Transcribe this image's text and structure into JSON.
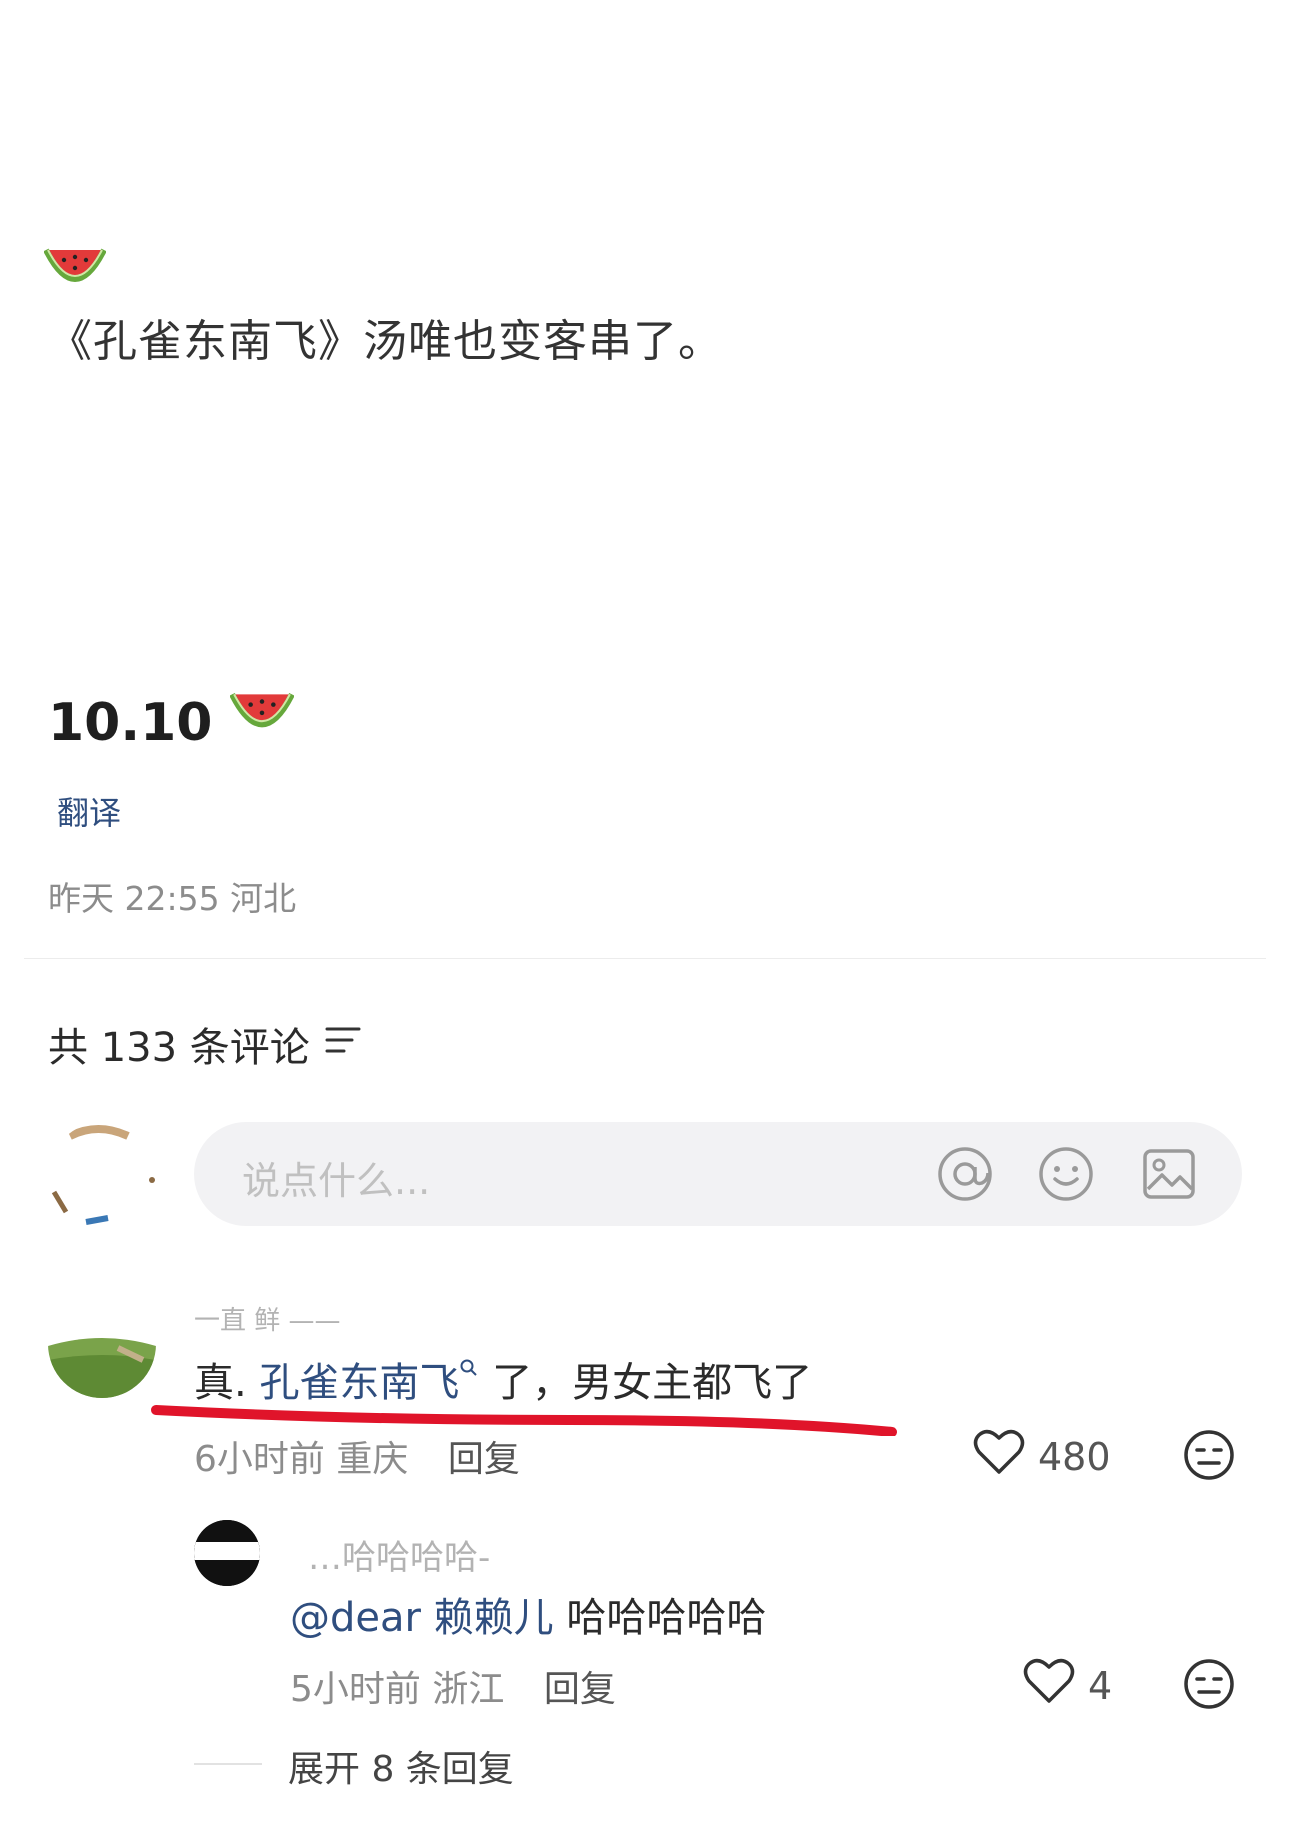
{
  "post": {
    "emoji": "watermelon",
    "text": "《孔雀东南飞》汤唯也变客串了。",
    "title": "10.10",
    "translate": "翻译",
    "meta": "昨天 22:55 河北"
  },
  "comments_header": {
    "count_label": "共 133 条评论",
    "icon": "sort-filter-icon"
  },
  "input": {
    "placeholder": "说点什么...",
    "icons": [
      "at-icon",
      "emoji-face-icon",
      "image-icon"
    ]
  },
  "comment": {
    "username": "一直 鲜 ——",
    "text_prefix": "真.",
    "text_link": "孔雀东南飞",
    "text_suffix": " 了，男女主都飞了",
    "time": "6小时前",
    "location": "重庆",
    "reply_label": "回复",
    "likes": "480",
    "annotation_color": "#e0142a"
  },
  "reply": {
    "username": "…哈哈哈哈-",
    "mention": "@dear 赖赖儿",
    "text": " 哈哈哈哈哈",
    "time": "5小时前",
    "location": "浙江",
    "reply_label": "回复",
    "likes": "4"
  },
  "expand": {
    "label": "展开 8 条回复"
  }
}
